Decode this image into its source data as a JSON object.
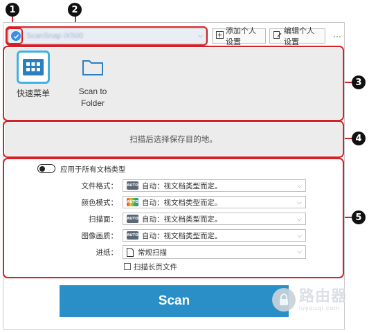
{
  "callouts": [
    "1",
    "2",
    "3",
    "4",
    "5"
  ],
  "toolbar": {
    "device_name": "ScanSnap iX500",
    "add_profile_label": "添加个人设置",
    "edit_profile_label": "编辑个人设置",
    "more_label": "···"
  },
  "presets": [
    {
      "label": "快速菜单",
      "icon": "grid-menu-icon",
      "active": true
    },
    {
      "label": "Scan to\nFolder",
      "icon": "folder-icon",
      "active": false
    }
  ],
  "destination_hint": "扫描后选择保存目的地。",
  "settings": {
    "apply_all_label": "应用于所有文档类型",
    "rows": [
      {
        "label": "文件格式：",
        "value": "自动：视文档类型而定。",
        "icon": "auto-format-icon"
      },
      {
        "label": "颜色模式：",
        "value": "自动：视文档类型而定。",
        "icon": "auto-color-icon"
      },
      {
        "label": "扫描面：",
        "value": "自动：视文档类型而定。",
        "icon": "auto-side-icon"
      },
      {
        "label": "图像画质：",
        "value": "自动：视文档类型而定。",
        "icon": "auto-quality-icon"
      },
      {
        "label": "进纸：",
        "value": "常规扫描",
        "icon": "document-icon"
      }
    ],
    "long_page_label": "扫描长页文件"
  },
  "scan_button_label": "Scan",
  "watermark": {
    "cn": "路由器",
    "en": "luyouqi.com"
  },
  "colors": {
    "accent": "#2a8fc6",
    "callout_outline": "#d61f26",
    "preset_highlight": "#3fb1e3"
  }
}
